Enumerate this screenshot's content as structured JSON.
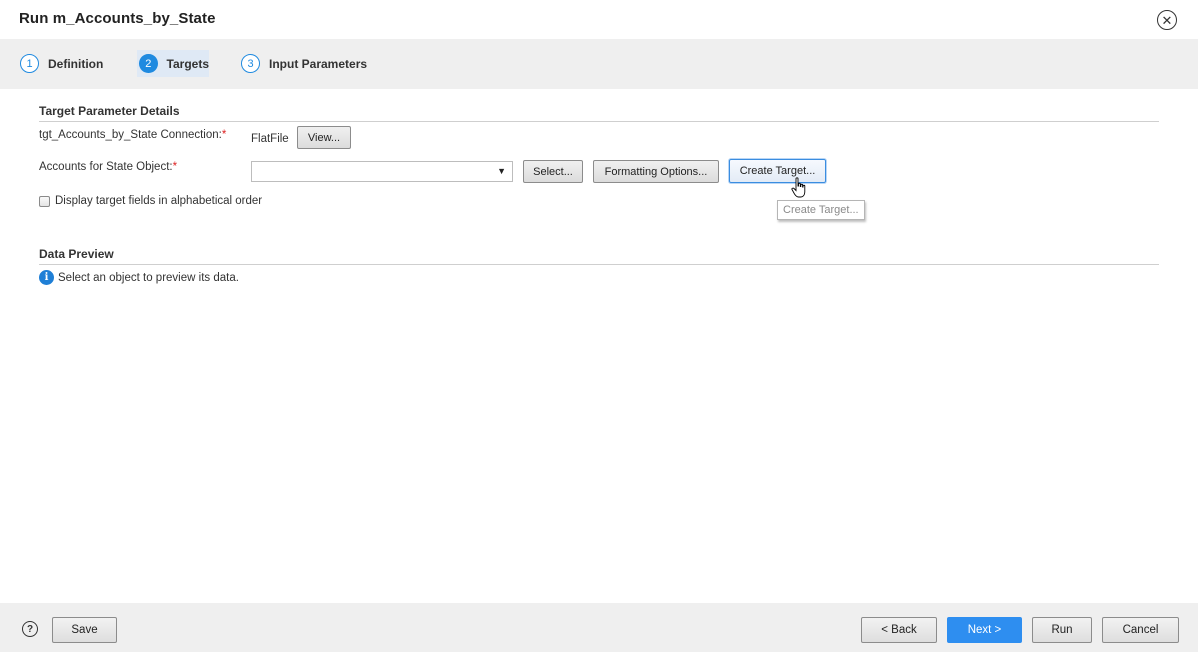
{
  "window": {
    "title": "Run m_Accounts_by_State"
  },
  "steps": [
    {
      "num": "1",
      "label": "Definition"
    },
    {
      "num": "2",
      "label": "Targets"
    },
    {
      "num": "3",
      "label": "Input Parameters"
    }
  ],
  "target_params": {
    "section_title": "Target Parameter Details",
    "connection_label": "tgt_Accounts_by_State Connection:",
    "connection_value": "FlatFile",
    "view_button": "View...",
    "object_label": "Accounts for State Object:",
    "object_value": "",
    "select_button": "Select...",
    "formatting_button": "Formatting Options...",
    "create_target_button": "Create Target...",
    "tooltip": "Create Target...",
    "alpha_order_label": "Display target fields in alphabetical order",
    "required_mark": "*"
  },
  "data_preview": {
    "section_title": "Data Preview",
    "info_text": "Select an object to preview its data."
  },
  "footer": {
    "save": "Save",
    "back": "< Back",
    "next": "Next >",
    "run": "Run",
    "cancel": "Cancel"
  },
  "colors": {
    "accent": "#2e8ef0",
    "step_active_bg": "#dfe9f5",
    "required": "#dd2222"
  }
}
